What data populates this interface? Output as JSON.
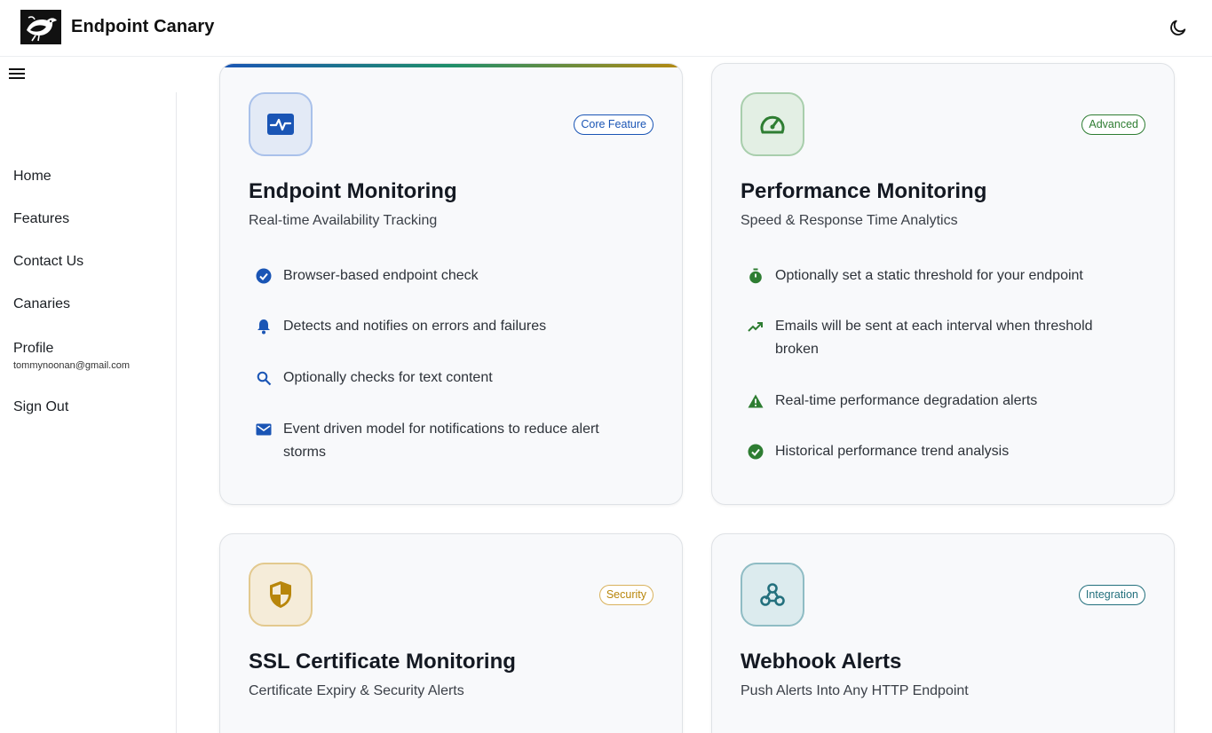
{
  "header": {
    "title": "Endpoint Canary",
    "logo_icon": "canary-bird-logo",
    "theme_icon": "moon-icon"
  },
  "sidebar": {
    "menu_icon": "hamburger-menu-icon",
    "items": [
      {
        "label": "Home"
      },
      {
        "label": "Features"
      },
      {
        "label": "Contact Us"
      },
      {
        "label": "Canaries"
      },
      {
        "label": "Profile"
      },
      {
        "label": "Sign Out"
      }
    ],
    "profile_email": "tommynoonan@gmail.com"
  },
  "cards": [
    {
      "title": "Endpoint Monitoring",
      "subtitle": "Real-time Availability Tracking",
      "badge": "Core Feature",
      "accent": "#1a55b5",
      "icon": "heartbeat-monitor-icon",
      "features": [
        {
          "icon": "check-circle-icon",
          "text": "Browser-based endpoint check"
        },
        {
          "icon": "bell-icon",
          "text": "Detects and notifies on errors and failures"
        },
        {
          "icon": "search-icon",
          "text": "Optionally checks for text content"
        },
        {
          "icon": "mail-icon",
          "text": "Event driven model for notifications to reduce alert storms"
        }
      ]
    },
    {
      "title": "Performance Monitoring",
      "subtitle": "Speed & Response Time Analytics",
      "badge": "Advanced",
      "accent": "#2e7d32",
      "icon": "speedometer-icon",
      "features": [
        {
          "icon": "stopwatch-icon",
          "text": "Optionally set a static threshold for your endpoint"
        },
        {
          "icon": "trending-up-icon",
          "text": "Emails will be sent at each interval when threshold broken"
        },
        {
          "icon": "warning-icon",
          "text": "Real-time performance degradation alerts"
        },
        {
          "icon": "check-circle-icon",
          "text": "Historical performance trend analysis"
        }
      ]
    },
    {
      "title": "SSL Certificate Monitoring",
      "subtitle": "Certificate Expiry & Security Alerts",
      "badge": "Security",
      "accent": "#b8860b",
      "icon": "shield-icon",
      "features": []
    },
    {
      "title": "Webhook Alerts",
      "subtitle": "Push Alerts Into Any HTTP Endpoint",
      "badge": "Integration",
      "accent": "#23707d",
      "icon": "webhook-icon",
      "features": []
    }
  ]
}
